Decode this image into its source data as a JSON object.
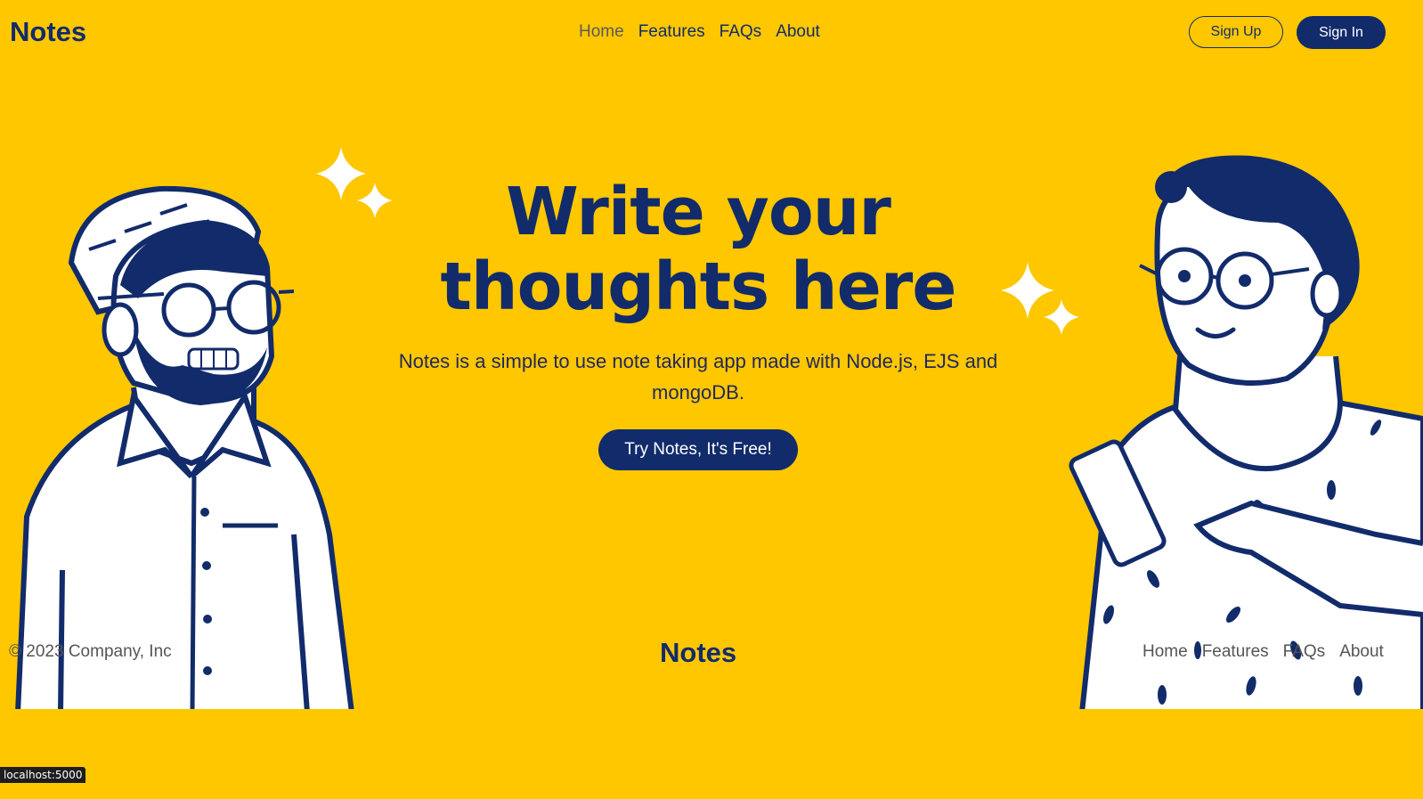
{
  "header": {
    "brand": "Notes",
    "nav": [
      {
        "label": "Home",
        "active": true
      },
      {
        "label": "Features",
        "active": false
      },
      {
        "label": "FAQs",
        "active": false
      },
      {
        "label": "About",
        "active": false
      }
    ],
    "sign_up": "Sign Up",
    "sign_in": "Sign In"
  },
  "hero": {
    "title_line1": "Write your",
    "title_line2": "thoughts here",
    "subtitle": "Notes is a simple to use note taking app made with Node.js, EJS and mongoDB.",
    "cta": "Try Notes, It's Free!"
  },
  "footer": {
    "copyright": "© 2023 Company, Inc",
    "brand": "Notes",
    "nav": [
      "Home",
      "Features",
      "FAQs",
      "About"
    ]
  },
  "status_bar": {
    "url": "localhost:5000"
  },
  "colors": {
    "background": "#FFC700",
    "primary": "#122B6B",
    "white": "#FFFFFF"
  },
  "icons": [
    "sparkle-icon"
  ]
}
